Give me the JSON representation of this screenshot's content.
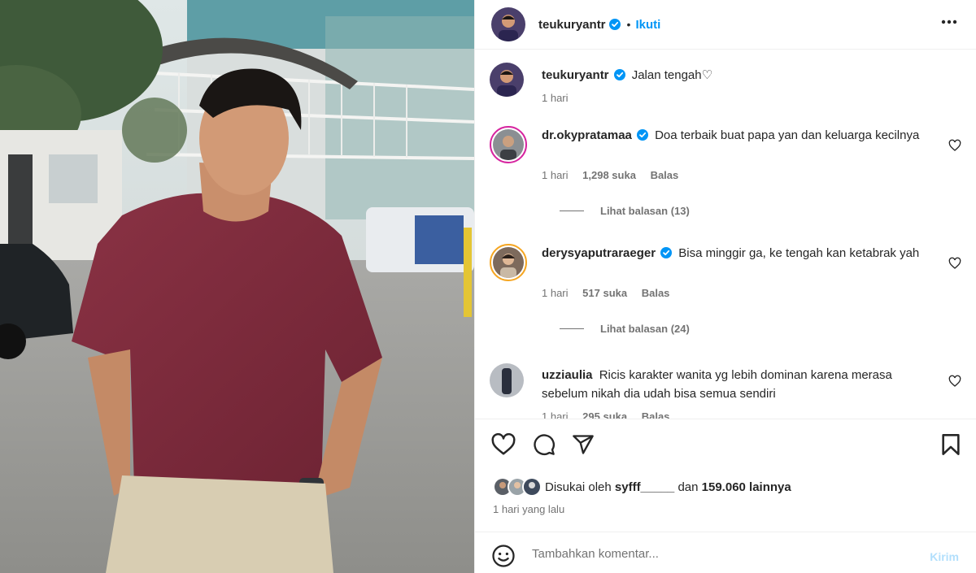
{
  "post": {
    "author": "teukuryantr",
    "follow_label": "Ikuti",
    "separator": "•",
    "more_icon": "more-horizontal-icon",
    "caption": {
      "username": "teukuryantr",
      "text": "Jalan tengah♡",
      "time": "1 hari"
    },
    "comments": [
      {
        "username": "dr.okypratamaa",
        "text": "Doa terbaik buat papa yan dan keluarga kecilnya",
        "time": "1 hari",
        "likes": "1,298 suka",
        "reply_label": "Balas",
        "view_replies": "Lihat balasan (13)"
      },
      {
        "username": "derysyaputraraeger",
        "text": "Bisa minggir ga, ke tengah kan ketabrak yah",
        "time": "1 hari",
        "likes": "517 suka",
        "reply_label": "Balas",
        "view_replies": "Lihat balasan (24)"
      },
      {
        "username": "uzziaulia",
        "text": "Ricis karakter wanita yg lebih dominan karena merasa sebelum nikah dia udah bisa semua sendiri",
        "time": "1 hari",
        "likes": "295 suka",
        "reply_label": "Balas"
      }
    ],
    "likes_prefix": "Disukai oleh",
    "likes_user": "syfff_____",
    "likes_middle": "dan",
    "likes_count": "159.060 lainnya",
    "posted_ago": "1 hari yang lalu",
    "comment_placeholder": "Tambahkan komentar...",
    "post_button": "Kirim"
  },
  "colors": {
    "accent": "#0095f6",
    "verified": "#0095f6",
    "shirt": "#7a2a3a"
  }
}
